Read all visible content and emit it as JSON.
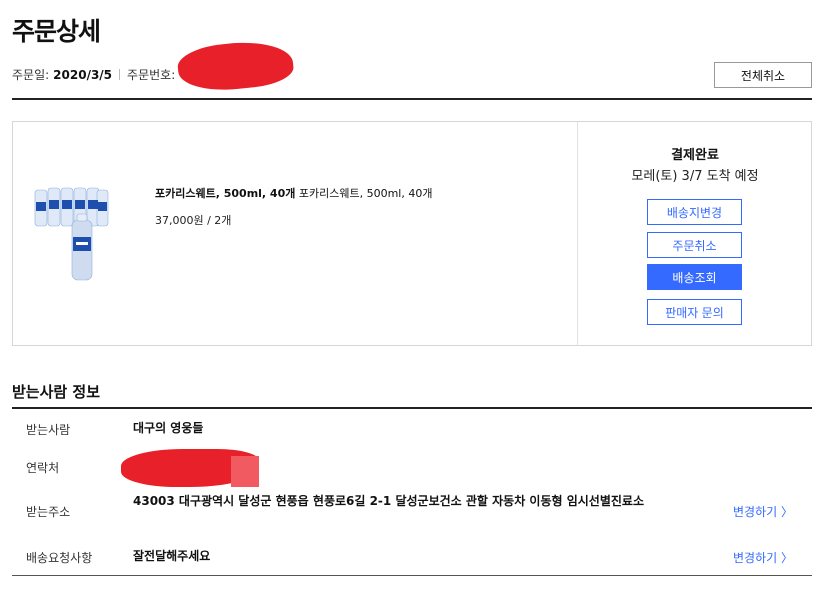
{
  "page": {
    "title": "주문상세",
    "order_date_label": "주문일:",
    "order_date": "2020/3/5",
    "order_no_label": "주문번호:",
    "cancel_all": "전체취소"
  },
  "order": {
    "product_name_bold": "포카리스웨트, 500ml, 40개",
    "product_name_option": "포카리스웨트, 500ml, 40개",
    "price_qty": "37,000원 / 2개",
    "status": "결제완료",
    "eta": "모레(토) 3/7 도착 예정",
    "buttons": {
      "change_address": "배송지변경",
      "cancel_order": "주문취소",
      "track": "배송조회",
      "ask_seller": "판매자 문의"
    }
  },
  "recipient": {
    "section_title": "받는사람 정보",
    "name_label": "받는사람",
    "name": "대구의 영웅들",
    "phone_label": "연락처",
    "address_label": "받는주소",
    "address": "43003 대구광역시 달성군 현풍읍 현풍로6길 2-1 달성군보건소 관할 자동차 이동형 임시선별진료소",
    "request_label": "배송요청사항",
    "request": "잘전달해주세요",
    "change_link": "변경하기 〉"
  },
  "colors": {
    "accent": "#346aff",
    "redaction": "#e8202a"
  }
}
